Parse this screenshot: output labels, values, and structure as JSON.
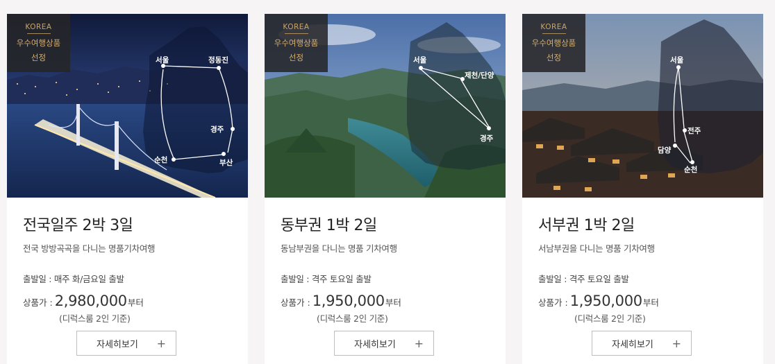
{
  "cards": [
    {
      "badge": {
        "korea": "KOREA",
        "line1": "우수여행상품",
        "line2": "선정"
      },
      "title": "전국일주 2박 3일",
      "subtitle": "전국 방방곡곡을 다니는 명품기차여행",
      "depart": "출발일 : 매주 화/금요일 출발",
      "price_label": "상품가 :",
      "price": "2,980,000",
      "price_suffix": "부터",
      "price_note": "(디럭스룸 2인 기준)",
      "button_label": "자세히보기",
      "button_icon": "+",
      "map_labels": [
        "서울",
        "정동진",
        "경주",
        "순천",
        "부산"
      ]
    },
    {
      "badge": {
        "korea": "KOREA",
        "line1": "우수여행상품",
        "line2": "선정"
      },
      "title": "동부권 1박 2일",
      "subtitle": "동남부권을 다니는 명품 기차여행",
      "depart": "출발일 : 격주 토요일 출발",
      "price_label": "상품가 :",
      "price": "1,950,000",
      "price_suffix": "부터",
      "price_note": "(디럭스룸 2인 기준)",
      "button_label": "자세히보기",
      "button_icon": "+",
      "map_labels": [
        "서울",
        "제천/단양",
        "경주"
      ]
    },
    {
      "badge": {
        "korea": "KOREA",
        "line1": "우수여행상품",
        "line2": "선정"
      },
      "title": "서부권 1박 2일",
      "subtitle": "서남부권을 다니는 명품 기차여행",
      "depart": "출발일 : 격주 토요일 출발",
      "price_label": "상품가 :",
      "price": "1,950,000",
      "price_suffix": "부터",
      "price_note": "(디럭스룸 2인 기준)",
      "button_label": "자세히보기",
      "button_icon": "+",
      "map_labels": [
        "서울",
        "전주",
        "담양",
        "순천"
      ]
    }
  ],
  "colors": {
    "badge_bg": "#262628",
    "badge_text": "#c9a56a",
    "page_bg": "#f6f4f4"
  }
}
